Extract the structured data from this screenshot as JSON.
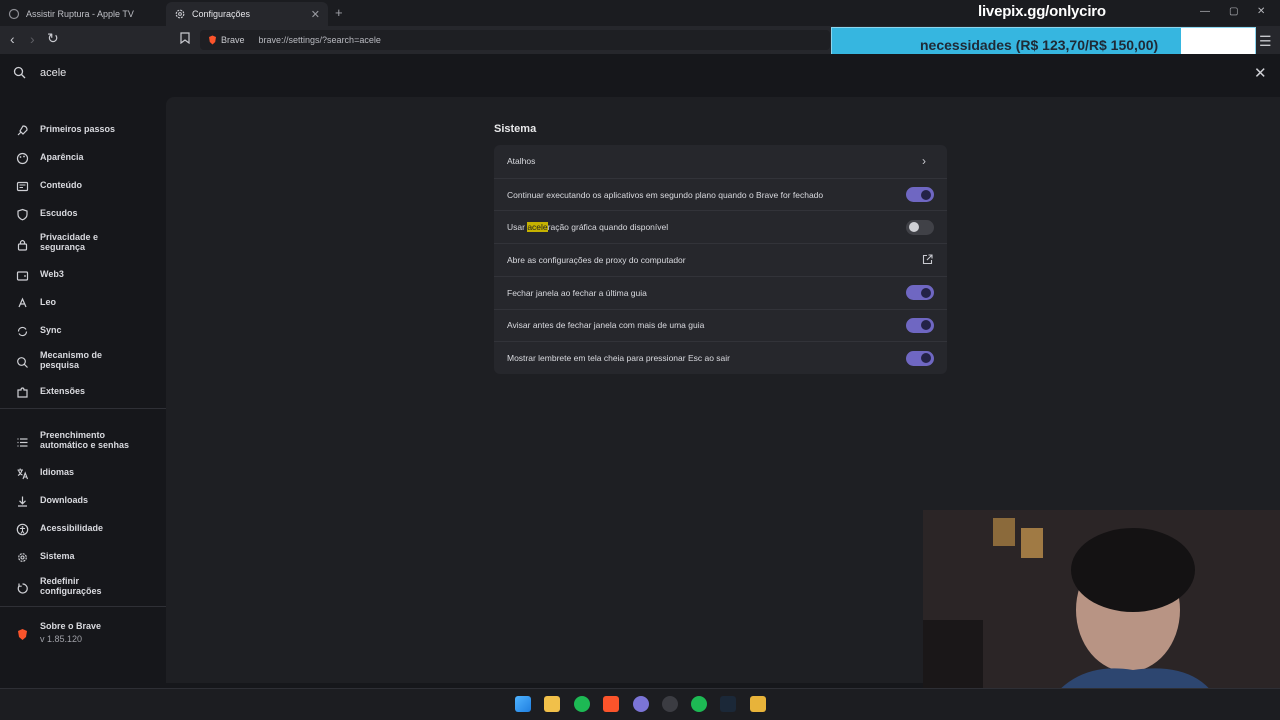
{
  "browser": {
    "tabs": [
      {
        "label": "Assistir Ruptura - Apple TV"
      },
      {
        "label": "Configurações"
      }
    ],
    "shield_label": "Brave",
    "url": "brave://settings/?search=acele"
  },
  "overlay": {
    "handle": "livepix.gg/onlyciro",
    "goal_text": "necessidades (R$ 123,70/R$ 150,00)",
    "goal_progress": 0.825,
    "goal_color": "#36b6e0"
  },
  "search": {
    "value": "acele"
  },
  "sidebar": {
    "items": [
      {
        "label": "Primeiros passos",
        "icon": "rocket-icon"
      },
      {
        "label": "Aparência",
        "icon": "palette-icon"
      },
      {
        "label": "Conteúdo",
        "icon": "content-icon"
      },
      {
        "label": "Escudos",
        "icon": "shield-icon"
      },
      {
        "label": "Privacidade e segurança",
        "icon": "lock-icon"
      },
      {
        "label": "Web3",
        "icon": "wallet-icon"
      },
      {
        "label": "Leo",
        "icon": "leo-icon"
      },
      {
        "label": "Sync",
        "icon": "sync-icon"
      },
      {
        "label": "Mecanismo de pesquisa",
        "icon": "search-engine-icon"
      },
      {
        "label": "Extensões",
        "icon": "puzzle-icon"
      },
      {
        "label": "Preenchimento automático e senhas",
        "icon": "autofill-icon"
      },
      {
        "label": "Idiomas",
        "icon": "language-icon"
      },
      {
        "label": "Downloads",
        "icon": "download-icon"
      },
      {
        "label": "Acessibilidade",
        "icon": "accessibility-icon"
      },
      {
        "label": "Sistema",
        "icon": "system-icon"
      },
      {
        "label": "Redefinir configurações",
        "icon": "reset-icon"
      }
    ],
    "about": {
      "label": "Sobre o Brave",
      "version": "v 1.85.120"
    }
  },
  "section": {
    "title": "Sistema",
    "rows": [
      {
        "label": "Atalhos",
        "control": "chevron"
      },
      {
        "label": "Continuar executando os aplicativos em segundo plano quando o Brave for fechado",
        "control": "toggle",
        "on": true
      },
      {
        "label_pre": "Usar ",
        "label_match": "acele",
        "label_post": "ração gráfica quando disponível",
        "control": "toggle",
        "on": false
      },
      {
        "label": "Abre as configurações de proxy do computador",
        "control": "external"
      },
      {
        "label": "Fechar janela ao fechar a última guia",
        "control": "toggle",
        "on": true
      },
      {
        "label": "Avisar antes de fechar janela com mais de uma guia",
        "control": "toggle",
        "on": true
      },
      {
        "label": "Mostrar lembrete em tela cheia para pressionar Esc ao sair",
        "control": "toggle",
        "on": true
      }
    ]
  },
  "colors": {
    "toggle_on": "#6f67c2",
    "highlight": "#c6b200",
    "brave_orange": "#fb542b"
  }
}
